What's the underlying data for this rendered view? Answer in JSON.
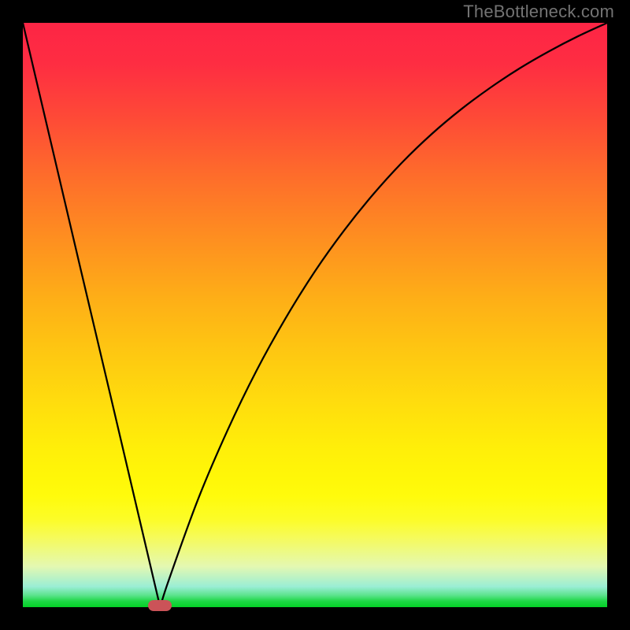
{
  "watermark": "TheBottleneck.com",
  "chart_data": {
    "type": "line",
    "title": "",
    "xlabel": "",
    "ylabel": "",
    "xlim": [
      0,
      100
    ],
    "ylim": [
      0,
      100
    ],
    "background_gradient": {
      "direction": "vertical",
      "top": "#fd2545",
      "bottom": "#04d127"
    },
    "x": [
      0,
      5,
      10,
      15,
      20,
      23.5,
      25,
      30,
      35,
      40,
      45,
      50,
      55,
      60,
      65,
      70,
      75,
      80,
      85,
      90,
      95,
      100
    ],
    "values": [
      100,
      78.7,
      57.4,
      36.2,
      14.9,
      0,
      4.7,
      18.5,
      30.2,
      40.5,
      49.5,
      57.5,
      64.5,
      70.7,
      76.2,
      81.0,
      85.2,
      88.9,
      92.2,
      95.1,
      97.7,
      100
    ],
    "series": [
      {
        "name": "bottleneck-curve",
        "x": [
          0,
          5,
          10,
          15,
          20,
          23.5,
          25,
          30,
          35,
          40,
          45,
          50,
          55,
          60,
          65,
          70,
          75,
          80,
          85,
          90,
          95,
          100
        ],
        "values": [
          100,
          78.7,
          57.4,
          36.2,
          14.9,
          0,
          4.7,
          18.5,
          30.2,
          40.5,
          49.5,
          57.5,
          64.5,
          70.7,
          76.2,
          81.0,
          85.2,
          88.9,
          92.2,
          95.1,
          97.7,
          100
        ]
      }
    ],
    "marker": {
      "x": 23.5,
      "y": 0,
      "color": "#cb5358",
      "shape": "pill"
    }
  }
}
